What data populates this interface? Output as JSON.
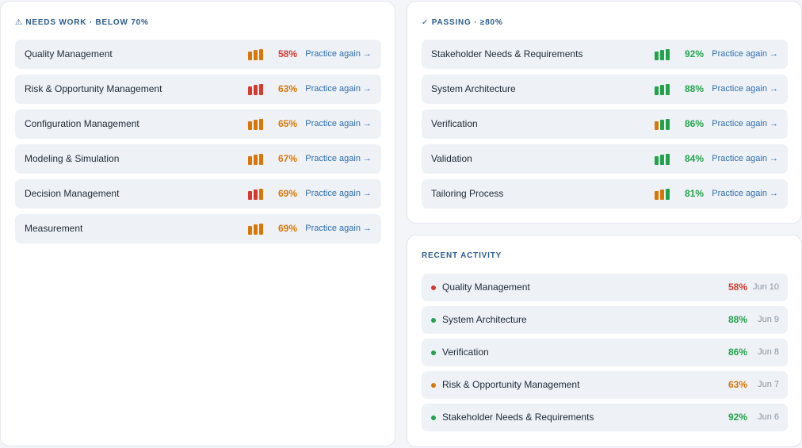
{
  "colors": {
    "red": "#d63a2f",
    "orange": "#d97706",
    "green": "#22a34a",
    "link": "#2f6db0",
    "title": "#2b5c8f"
  },
  "needs_work": {
    "title": "⚠ NEEDS WORK · BELOW 70%",
    "items": [
      {
        "label": "Quality Management",
        "pct": "58%",
        "pct_color": "red",
        "bars": [
          "orange",
          "orange",
          "orange"
        ],
        "action": "Practice again →"
      },
      {
        "label": "Risk & Opportunity Management",
        "pct": "63%",
        "pct_color": "orange",
        "bars": [
          "red",
          "red",
          "red"
        ],
        "action": "Practice again →"
      },
      {
        "label": "Configuration Management",
        "pct": "65%",
        "pct_color": "orange",
        "bars": [
          "orange",
          "orange",
          "orange"
        ],
        "action": "Practice again →"
      },
      {
        "label": "Modeling & Simulation",
        "pct": "67%",
        "pct_color": "orange",
        "bars": [
          "orange",
          "orange",
          "orange"
        ],
        "action": "Practice again →"
      },
      {
        "label": "Decision Management",
        "pct": "69%",
        "pct_color": "orange",
        "bars": [
          "red",
          "red",
          "orange"
        ],
        "action": "Practice again →"
      },
      {
        "label": "Measurement",
        "pct": "69%",
        "pct_color": "orange",
        "bars": [
          "orange",
          "orange",
          "orange"
        ],
        "action": "Practice again →"
      }
    ]
  },
  "passing": {
    "title": "✓ PASSING · ≥80%",
    "items": [
      {
        "label": "Stakeholder Needs & Requirements",
        "pct": "92%",
        "pct_color": "green",
        "bars": [
          "green",
          "green",
          "green"
        ],
        "action": "Practice again →"
      },
      {
        "label": "System Architecture",
        "pct": "88%",
        "pct_color": "green",
        "bars": [
          "green",
          "green",
          "green"
        ],
        "action": "Practice again →"
      },
      {
        "label": "Verification",
        "pct": "86%",
        "pct_color": "green",
        "bars": [
          "orange",
          "green",
          "green"
        ],
        "action": "Practice again →"
      },
      {
        "label": "Validation",
        "pct": "84%",
        "pct_color": "green",
        "bars": [
          "green",
          "green",
          "green"
        ],
        "action": "Practice again →"
      },
      {
        "label": "Tailoring Process",
        "pct": "81%",
        "pct_color": "green",
        "bars": [
          "orange",
          "orange",
          "green"
        ],
        "action": "Practice again →"
      }
    ]
  },
  "recent_activity": {
    "title": "RECENT ACTIVITY",
    "items": [
      {
        "label": "Quality Management",
        "pct": "58%",
        "color": "red",
        "date": "Jun 10"
      },
      {
        "label": "System Architecture",
        "pct": "88%",
        "color": "green",
        "date": "Jun 9"
      },
      {
        "label": "Verification",
        "pct": "86%",
        "color": "green",
        "date": "Jun 8"
      },
      {
        "label": "Risk & Opportunity Management",
        "pct": "63%",
        "color": "orange",
        "date": "Jun 7"
      },
      {
        "label": "Stakeholder Needs & Requirements",
        "pct": "92%",
        "color": "green",
        "date": "Jun 6"
      }
    ]
  }
}
